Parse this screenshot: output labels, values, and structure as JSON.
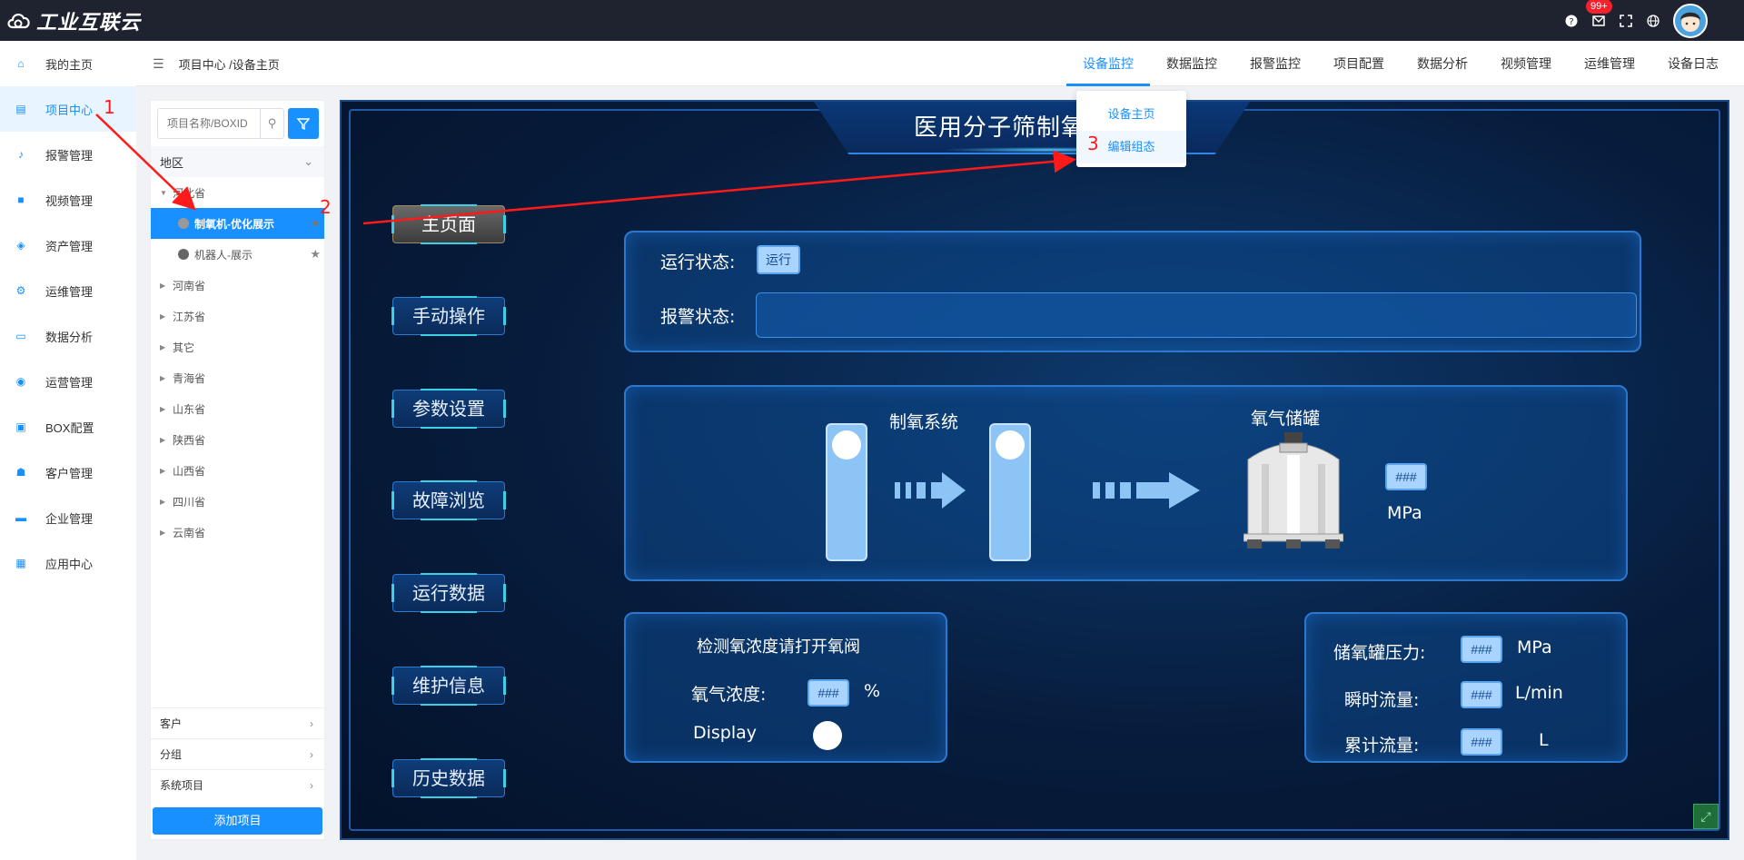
{
  "app": {
    "logo_text": "工业互联云"
  },
  "topbar": {
    "notif_badge": "99+",
    "icons": [
      "help-icon",
      "mail-icon",
      "fullscreen-icon",
      "globe-icon"
    ]
  },
  "leftnav": {
    "items": [
      {
        "label": "我的主页",
        "icon": "home-icon"
      },
      {
        "label": "项目中心",
        "icon": "project-icon",
        "active": true
      },
      {
        "label": "报警管理",
        "icon": "bell-icon"
      },
      {
        "label": "视频管理",
        "icon": "video-icon"
      },
      {
        "label": "资产管理",
        "icon": "asset-icon"
      },
      {
        "label": "运维管理",
        "icon": "gear-icon"
      },
      {
        "label": "数据分析",
        "icon": "monitor-icon"
      },
      {
        "label": "运营管理",
        "icon": "shield-icon"
      },
      {
        "label": "BOX配置",
        "icon": "box-icon"
      },
      {
        "label": "客户管理",
        "icon": "users-icon"
      },
      {
        "label": "企业管理",
        "icon": "briefcase-icon"
      },
      {
        "label": "应用中心",
        "icon": "apps-icon"
      }
    ]
  },
  "header": {
    "breadcrumb": "项目中心 /设备主页",
    "menu": [
      "设备监控",
      "数据监控",
      "报警监控",
      "项目配置",
      "数据分析",
      "视频管理",
      "运维管理",
      "设备日志"
    ],
    "active_menu": "设备监控"
  },
  "dropdown": {
    "items": [
      "设备主页",
      "编辑组态"
    ]
  },
  "project_panel": {
    "search_placeholder": "项目名称/BOXID",
    "region_label": "地区",
    "tree": {
      "root": "河北省",
      "children": [
        "制氧机-优化展示",
        "机器人-展示"
      ],
      "selected": "制氧机-优化展示",
      "others": [
        "河南省",
        "江苏省",
        "其它",
        "青海省",
        "山东省",
        "陕西省",
        "山西省",
        "四川省",
        "云南省"
      ]
    },
    "bottom": [
      "客户",
      "分组",
      "系统项目"
    ],
    "add_button": "添加项目"
  },
  "hmi": {
    "title": "医用分子筛制氧",
    "side_buttons": [
      "主页面",
      "手动操作",
      "参数设置",
      "故障浏览",
      "运行数据",
      "维护信息",
      "历史数据"
    ],
    "active_side": "主页面",
    "status": {
      "run_label": "运行状态:",
      "run_value": "运行",
      "alarm_label": "报警状态:"
    },
    "process": {
      "system_label": "制氧系统",
      "tank_label": "氧气储罐",
      "tank_value": "###",
      "tank_unit": "MPa"
    },
    "oxygen": {
      "hint": "检测氧浓度请打开氧阀",
      "conc_label": "氧气浓度:",
      "conc_value": "###",
      "conc_unit": "%",
      "display_label": "Display"
    },
    "tank_stats": [
      {
        "label": "储氧罐压力:",
        "value": "###",
        "unit": "MPa"
      },
      {
        "label": "瞬时流量:",
        "value": "###",
        "unit": "L/min"
      },
      {
        "label": "累计流量:",
        "value": "###",
        "unit": "L"
      }
    ]
  },
  "annotations": [
    "1",
    "2",
    "3"
  ],
  "colors": {
    "accent": "#1890ff",
    "topbar": "#1f2330",
    "hmi_bg": "#071c3c",
    "annotation": "#ff1a1a"
  }
}
